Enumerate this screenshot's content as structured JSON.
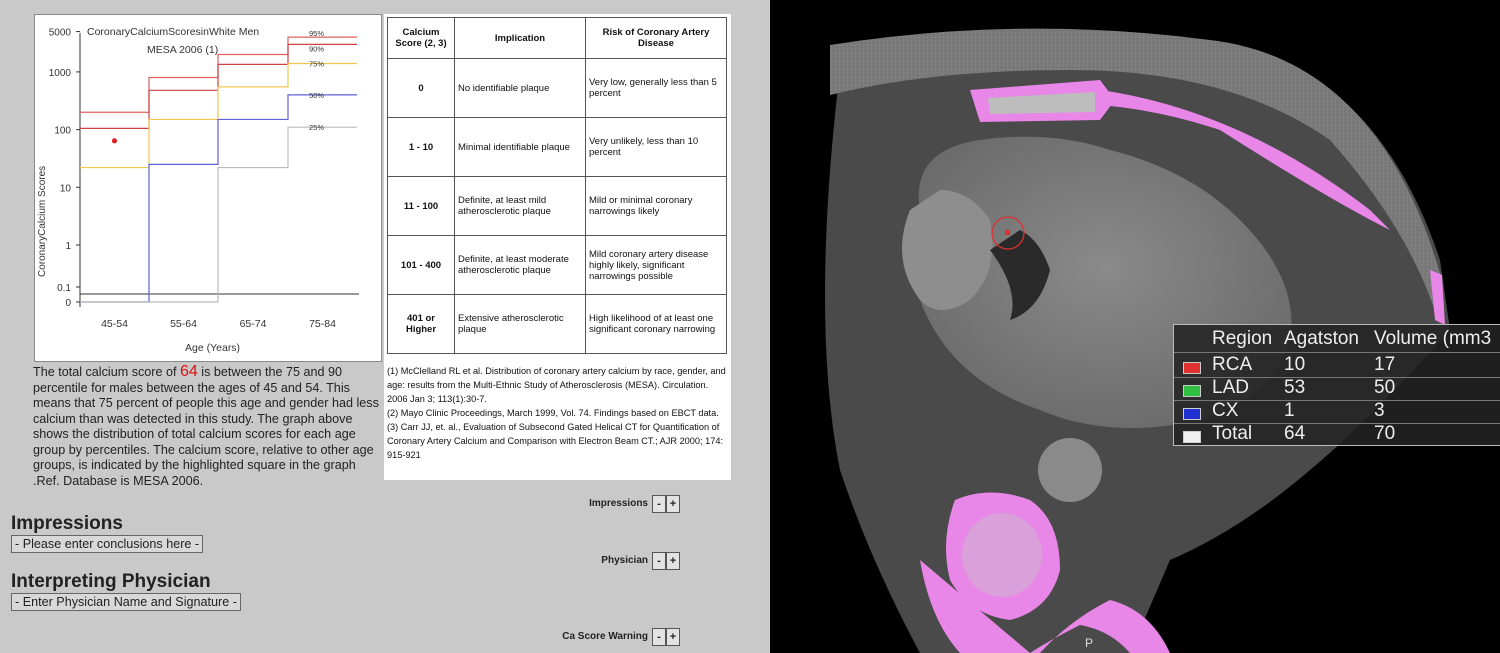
{
  "chart": {
    "title_line1": "CoronaryCalciumScoresinWhite Men",
    "title_line2": "MESA 2006 (1)",
    "ylabel": "CoronaryCalcium Scores",
    "xlabel": "Age (Years)",
    "y_ticks": [
      "5000",
      "1000",
      "100",
      "10",
      "1",
      "0.1",
      "0"
    ],
    "x_ticks": [
      "45-54",
      "55-64",
      "65-74",
      "75-84"
    ],
    "percentiles": [
      "95%",
      "90%",
      "75%",
      "50%",
      "25%"
    ]
  },
  "chart_data": {
    "type": "line",
    "title": "CoronaryCalciumScoresinWhite Men MESA 2006 (1)",
    "xlabel": "Age (Years)",
    "ylabel": "CoronaryCalcium Scores",
    "y_scale": "log",
    "categories": [
      "45-54",
      "55-64",
      "65-74",
      "75-84"
    ],
    "series": [
      {
        "name": "95%",
        "color": "#e06060",
        "values": [
          200,
          800,
          2000,
          4000
        ]
      },
      {
        "name": "90%",
        "color": "#d04040",
        "values": [
          105,
          480,
          1350,
          3000
        ]
      },
      {
        "name": "75%",
        "color": "#f0c850",
        "values": [
          22,
          150,
          550,
          1400
        ]
      },
      {
        "name": "50%",
        "color": "#6060d8",
        "values": [
          0,
          25,
          150,
          400
        ]
      },
      {
        "name": "25%",
        "color": "#bbbbbb",
        "values": [
          0,
          0,
          22,
          110
        ]
      }
    ],
    "patient_point": {
      "category": "45-54",
      "value": 64,
      "color": "#d22"
    }
  },
  "ref_table": {
    "headers": [
      "Calcium Score (2, 3)",
      "Implication",
      "Risk of Coronary Artery Disease"
    ],
    "rows": [
      {
        "score": "0",
        "implication": "No identifiable plaque",
        "risk": "Very low, generally less than 5 percent"
      },
      {
        "score": "1 - 10",
        "implication": "Minimal identifiable plaque",
        "risk": "Very unlikely, less than 10 percent"
      },
      {
        "score": "11 - 100",
        "implication": "Definite, at least mild atherosclerotic plaque",
        "risk": "Mild or minimal coronary narrowings likely"
      },
      {
        "score": "101 - 400",
        "implication": "Definite, at least moderate atherosclerotic plaque",
        "risk": "Mild coronary artery disease highly likely, significant narrowings possible"
      },
      {
        "score": "401 or Higher",
        "implication": "Extensive atherosclerotic plaque",
        "risk": "High likelihood of at least one significant coronary narrowing"
      }
    ],
    "references": [
      "(1) McClelland RL et al. Distribution of coronary artery calcium by race, gender, and age: results from the Multi-Ethnic Study of Atherosclerosis (MESA). Circulation. 2006 Jan 3; 113(1):30-7.",
      "(2) Mayo Clinic Proceedings, March 1999, Vol. 74. Findings based on EBCT data.",
      "(3) Carr JJ, et. al., Evaluation of Subsecond Gated Helical CT for Quantification of Coronary Artery Calcium and Comparison with Electron Beam CT.; AJR 2000; 174: 915-921"
    ]
  },
  "summary": {
    "prefix": "The total calcium score of ",
    "score": "64",
    "suffix": " is between the 75 and 90 percentile for males between the ages of 45 and 54. This means that 75 percent of people this age and gender had less calcium than was detected in this study. The graph above shows the distribution of total calcium scores for each age group by percentiles. The calcium score, relative to other age groups, is indicated by the highlighted square in the graph .Ref. Database is MESA 2006."
  },
  "impressions": {
    "heading": "Impressions",
    "placeholder": "- Please enter conclusions here -"
  },
  "physician": {
    "heading": "Interpreting Physician",
    "placeholder": "- Enter Physician Name and Signature -"
  },
  "controls": [
    {
      "label": "Impressions",
      "minus": "-",
      "plus": "+"
    },
    {
      "label": "Physician",
      "minus": "-",
      "plus": "+"
    },
    {
      "label": "Ca Score Warning",
      "minus": "-",
      "plus": "+"
    }
  ],
  "legend": {
    "headers": [
      "Region",
      "Agatston",
      "Volume (mm3"
    ],
    "rows": [
      {
        "region": "RCA",
        "agatston": "10",
        "volume": "17",
        "color": "#e03030"
      },
      {
        "region": "LAD",
        "agatston": "53",
        "volume": "50",
        "color": "#30c040"
      },
      {
        "region": "CX",
        "agatston": "1",
        "volume": "3",
        "color": "#2030d0"
      },
      {
        "region": "Total",
        "agatston": "64",
        "volume": "70",
        "color": "#f0f0f0"
      }
    ]
  },
  "ct": {
    "orientation_marker": "P"
  }
}
